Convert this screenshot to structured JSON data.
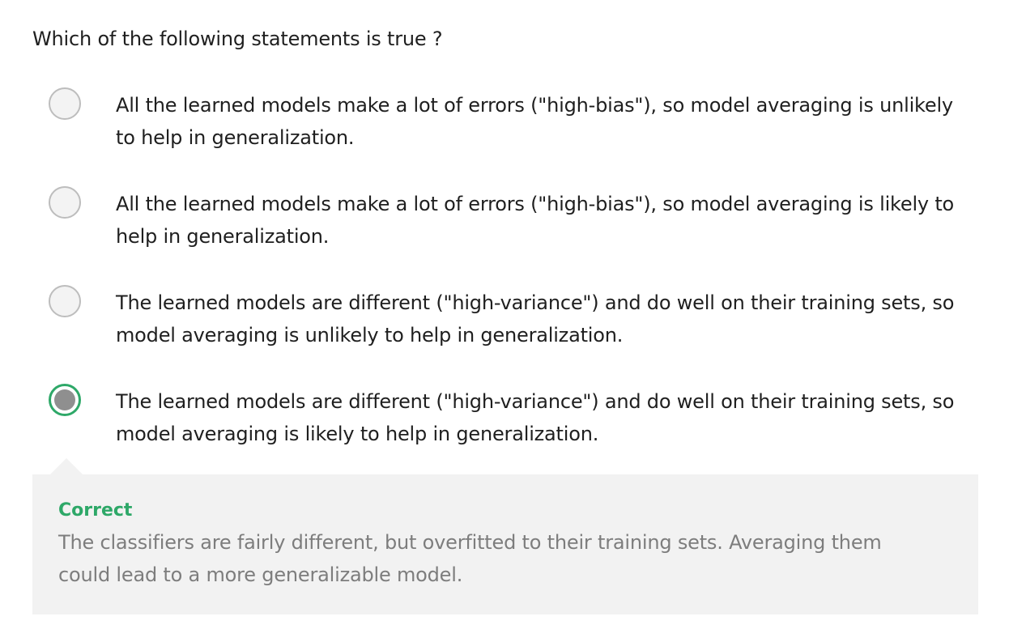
{
  "question": {
    "text": "Which of the following statements is true ?"
  },
  "options": [
    {
      "text": "All the learned models make a lot of errors (\"high-bias\"), so model averaging is unlikely to help in generalization.",
      "selected": false
    },
    {
      "text": "All the learned models make a lot of errors (\"high-bias\"), so model averaging is likely to help in generalization.",
      "selected": false
    },
    {
      "text": "The learned models are different (\"high-variance\") and do well on their training sets, so model averaging is unlikely to help in generalization.",
      "selected": false
    },
    {
      "text": "The learned models are different (\"high-variance\") and do well on their training sets, so model averaging is likely to help in generalization.",
      "selected": true
    }
  ],
  "feedback": {
    "status": "Correct",
    "explanation": "The classifiers are fairly different, but overfitted to their training sets. Averaging them could lead to a more generalizable model."
  },
  "colors": {
    "correct": "#2ea868",
    "feedback_bg": "#f2f2f2",
    "explanation_text": "#7d7d7d",
    "radio_unselected_border": "#bdbdbd",
    "radio_selected_dot": "#8f8f8f"
  }
}
